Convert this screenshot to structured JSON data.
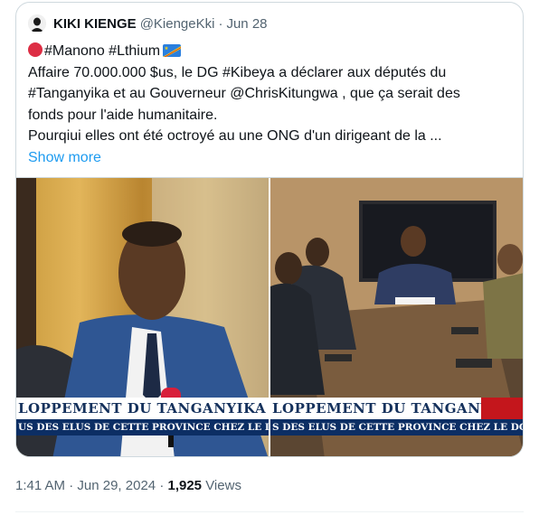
{
  "tweet": {
    "author_name": "KIKI KIENGE",
    "author_handle": "@KiengeKki",
    "separator": "·",
    "posted_date": "Jun 28",
    "lines": [
      "#Manono #Lthium",
      "Affaire 70.000.000 $us, le DG #Kibeya a déclarer aux députés du",
      "#Tanganyika et au Gouverneur @ChrisKitungwa , que ça serait des",
      "fonds pour l'aide humanitaire.",
      "Pourqiui elles ont été octroyé au une ONG d'un dirigeant de la ..."
    ],
    "show_more": "Show more"
  },
  "media": {
    "left": {
      "banner": "LOPPEMENT DU TANGANYIKA",
      "ticker": "US DES ELUS DE CETTE PROVINCE CHEZ LE DG DE LA CO"
    },
    "right": {
      "banner": "LOPPEMENT DU TANGANYIKA",
      "ticker": "S DES ELUS DE CETTE PROVINCE CHEZ LE DG DE LA COM"
    }
  },
  "meta": {
    "time": "1:41 AM",
    "separator": "·",
    "date": "Jun 29, 2024",
    "separator2": "·",
    "views_count": "1,925",
    "views_label": "Views"
  },
  "colors": {
    "link": "#1d9bf0",
    "secondary_text": "#536471",
    "border": "#cfd9de",
    "banner_text": "#15315c",
    "ticker_bg": "#0c2e64"
  }
}
